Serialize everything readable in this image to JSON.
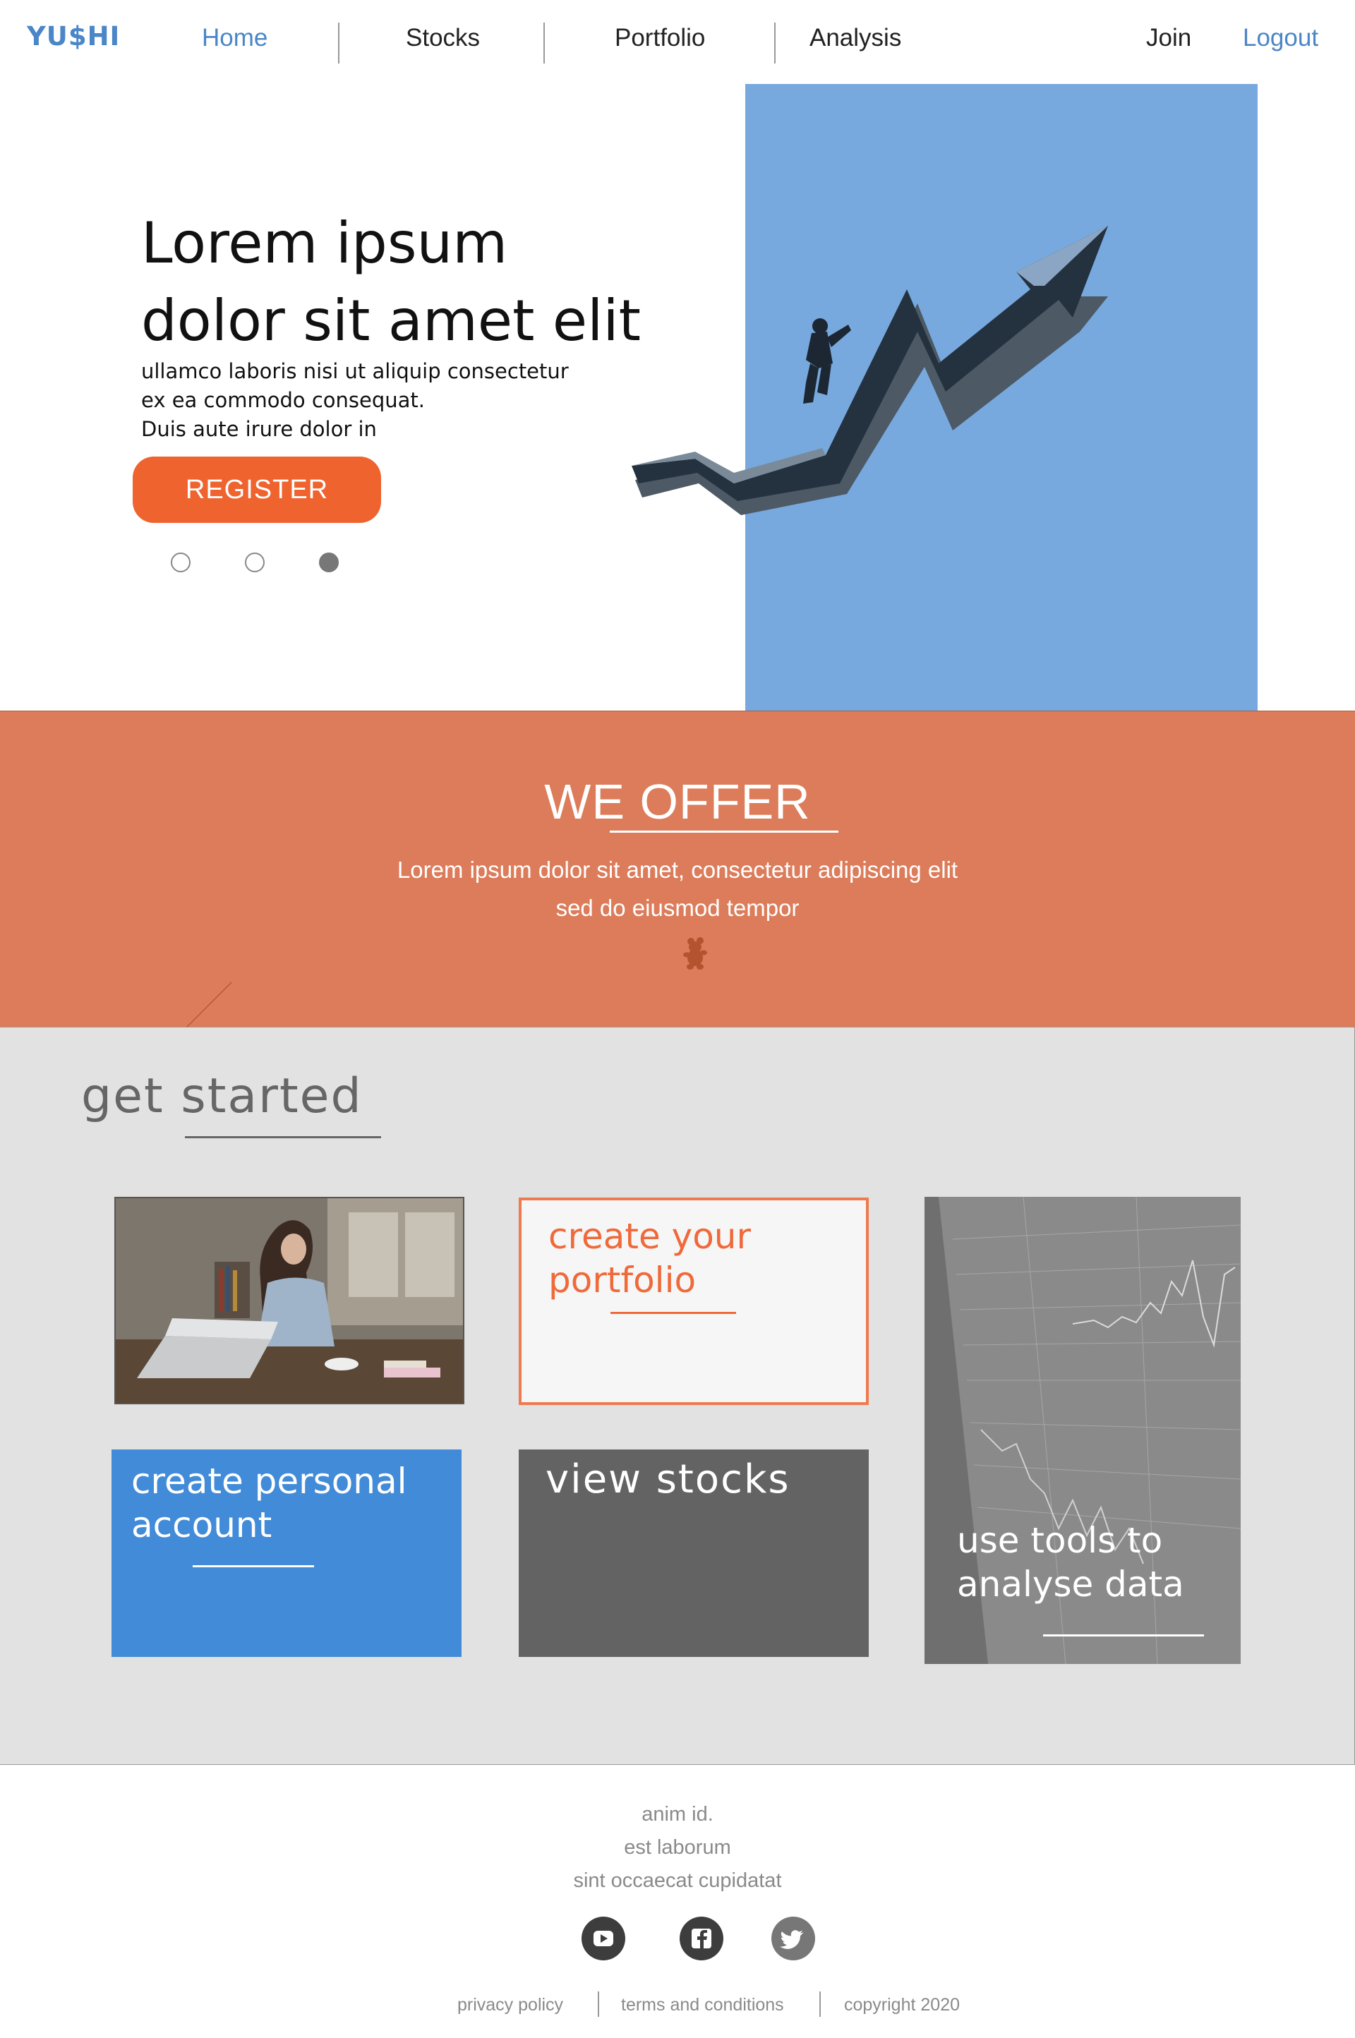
{
  "nav": {
    "logo": "YU$HI",
    "items": [
      "Home",
      "Stocks",
      "Portfolio",
      "Analysis"
    ],
    "join": "Join",
    "logout": "Logout"
  },
  "hero": {
    "title_lines": [
      "Lorem ipsum",
      "dolor sit amet elit"
    ],
    "subtitle_lines": [
      "ullamco laboris nisi ut aliquip consectetur",
      "ex ea commodo consequat.",
      "Duis aute irure dolor in"
    ],
    "cta": "REGISTER",
    "active_slide": 3,
    "total_slides": 3
  },
  "offer": {
    "title": "WE OFFER",
    "text_lines": [
      "Lorem ipsum dolor sit amet, consectetur adipiscing elit",
      "sed do eiusmod tempor"
    ],
    "icon": "bear-icon"
  },
  "get_started": {
    "title": "get started",
    "cards": {
      "portfolio": "create your portfolio",
      "account": "create personal account",
      "stocks": "view stocks",
      "tools": "use tools to analyse data"
    }
  },
  "footer": {
    "links": [
      "anim id.",
      "est laborum",
      "sint occaecat cupidatat"
    ],
    "social": [
      "youtube-icon",
      "facebook-icon",
      "twitter-icon"
    ],
    "legal": [
      "privacy policy",
      "terms and conditions",
      "copyright 2020"
    ]
  },
  "colors": {
    "brand_blue": "#4a86c8",
    "accent_orange": "#ef632f",
    "offer_bg": "#dc7c5a",
    "hero_blue": "#77a9de",
    "section_gray": "#e2e2e2"
  }
}
